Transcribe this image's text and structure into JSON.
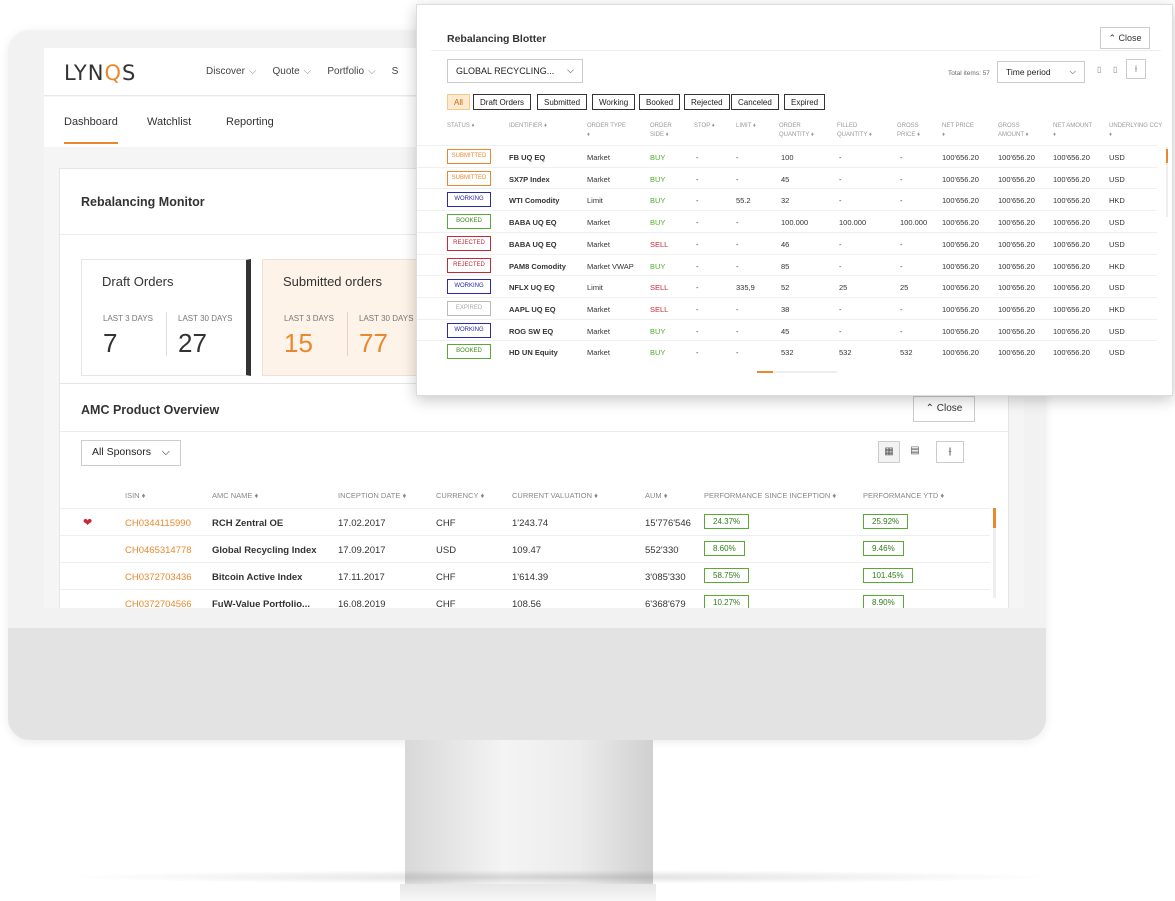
{
  "app": {
    "logo_left": "LYN",
    "logo_accent": "Q",
    "logo_right": "S",
    "nav": [
      "Discover",
      "Quote",
      "Portfolio",
      "S"
    ],
    "tabs": [
      "Dashboard",
      "Watchlist",
      "Reporting"
    ],
    "active_tab": "Dashboard",
    "accent_color": "#e8892f"
  },
  "rebalancing_monitor": {
    "title": "Rebalancing Monitor",
    "draft": {
      "title": "Draft Orders",
      "label_3": "LAST 3 DAYS",
      "label_30": "LAST 30 DAYS",
      "val_3": "7",
      "val_30": "27"
    },
    "submitted": {
      "title": "Submitted orders",
      "label_3": "LAST 3 DAYS",
      "label_30": "LAST 30 DAYS",
      "val_3": "15",
      "val_30": "77"
    }
  },
  "amc": {
    "title": "AMC Product Overview",
    "close_label": "Close",
    "sponsor_select": "All Sponsors",
    "columns": [
      "ISIN",
      "AMC NAME",
      "INCEPTION DATE",
      "CURRENCY",
      "CURRENT VALUATION",
      "AUM",
      "PERFORMANCE SINCE INCEPTION",
      "PERFORMANCE YTD"
    ],
    "rows": [
      {
        "isin": "CH0344115990",
        "name": "RCH Zentral OE",
        "date": "17.02.2017",
        "ccy": "CHF",
        "val": "1'243.74",
        "aum": "15'776'546",
        "perf": "24.37%",
        "ytd": "25.92%"
      },
      {
        "isin": "CH0465314778",
        "name": "Global Recycling Index",
        "date": "17.09.2017",
        "ccy": "USD",
        "val": "109.47",
        "aum": "552'330",
        "perf": "8.60%",
        "ytd": "9.46%"
      },
      {
        "isin": "CH0372703436",
        "name": "Bitcoin Active Index",
        "date": "17.11.2017",
        "ccy": "CHF",
        "val": "1'614.39",
        "aum": "3'085'330",
        "perf": "58.75%",
        "ytd": "101.45%"
      },
      {
        "isin": "CH0372704566",
        "name": "FuW-Value Portfolio...",
        "date": "16.08.2019",
        "ccy": "CHF",
        "val": "108.56",
        "aum": "6'368'679",
        "perf": "10.27%",
        "ytd": "8.90%"
      }
    ]
  },
  "blotter": {
    "title": "Rebalancing Blotter",
    "close_label": "Close",
    "product_select": "GLOBAL RECYCLING...",
    "total": "Total items: 57",
    "time_period": "Time period",
    "filters": [
      "All",
      "Draft Orders",
      "Submitted",
      "Working",
      "Booked",
      "Rejected",
      "Canceled",
      "Expired"
    ],
    "active_filter": "All",
    "columns": [
      "STATUS",
      "IDENTIFIER",
      "ORDER TYPE",
      "ORDER SIDE",
      "STOP",
      "LIMIT",
      "ORDER QUANTITY",
      "FILLED QUANTITY",
      "GROSS PRICE",
      "NET PRICE",
      "GROSS AMOUNT",
      "NET AMOUNT",
      "UNDERLYING CCY"
    ],
    "rows": [
      {
        "status": "SUBMITTED",
        "id": "FB UQ EQ",
        "type": "Market",
        "side": "BUY",
        "stop": "-",
        "limit": "-",
        "qty": "100",
        "filled": "-",
        "gross": "-",
        "net": "100'656.20",
        "gamt": "100'656.20",
        "namt": "100'656.20",
        "ccy": "USD"
      },
      {
        "status": "SUBMITTED",
        "id": "SX7P Index",
        "type": "Market",
        "side": "BUY",
        "stop": "-",
        "limit": "-",
        "qty": "45",
        "filled": "-",
        "gross": "-",
        "net": "100'656.20",
        "gamt": "100'656.20",
        "namt": "100'656.20",
        "ccy": "USD"
      },
      {
        "status": "WORKING",
        "id": "WTI Comodity",
        "type": "Limit",
        "side": "BUY",
        "stop": "-",
        "limit": "55.2",
        "qty": "32",
        "filled": "-",
        "gross": "-",
        "net": "100'656.20",
        "gamt": "100'656.20",
        "namt": "100'656.20",
        "ccy": "HKD"
      },
      {
        "status": "BOOKED",
        "id": "BABA UQ EQ",
        "type": "Market",
        "side": "BUY",
        "stop": "-",
        "limit": "-",
        "qty": "100.000",
        "filled": "100.000",
        "gross": "100.000",
        "net": "100'656.20",
        "gamt": "100'656.20",
        "namt": "100'656.20",
        "ccy": "USD"
      },
      {
        "status": "REJECTED",
        "id": "BABA UQ EQ",
        "type": "Market",
        "side": "SELL",
        "stop": "-",
        "limit": "-",
        "qty": "46",
        "filled": "-",
        "gross": "-",
        "net": "100'656.20",
        "gamt": "100'656.20",
        "namt": "100'656.20",
        "ccy": "USD"
      },
      {
        "status": "REJECTED",
        "id": "PAM8 Comodity",
        "type": "Market VWAP",
        "side": "BUY",
        "stop": "-",
        "limit": "-",
        "qty": "85",
        "filled": "-",
        "gross": "-",
        "net": "100'656.20",
        "gamt": "100'656.20",
        "namt": "100'656.20",
        "ccy": "HKD"
      },
      {
        "status": "WORKING",
        "id": "NFLX UQ EQ",
        "type": "Limit",
        "side": "SELL",
        "stop": "-",
        "limit": "335,9",
        "qty": "52",
        "filled": "25",
        "gross": "25",
        "net": "100'656.20",
        "gamt": "100'656.20",
        "namt": "100'656.20",
        "ccy": "USD"
      },
      {
        "status": "EXPIRED",
        "id": "AAPL UQ EQ",
        "type": "Market",
        "side": "SELL",
        "stop": "-",
        "limit": "-",
        "qty": "38",
        "filled": "-",
        "gross": "-",
        "net": "100'656.20",
        "gamt": "100'656.20",
        "namt": "100'656.20",
        "ccy": "HKD"
      },
      {
        "status": "WORKING",
        "id": "ROG SW EQ",
        "type": "Market",
        "side": "BUY",
        "stop": "-",
        "limit": "-",
        "qty": "45",
        "filled": "-",
        "gross": "-",
        "net": "100'656.20",
        "gamt": "100'656.20",
        "namt": "100'656.20",
        "ccy": "USD"
      },
      {
        "status": "BOOKED",
        "id": "HD UN Equity",
        "type": "Market",
        "side": "BUY",
        "stop": "-",
        "limit": "-",
        "qty": "532",
        "filled": "532",
        "gross": "532",
        "net": "100'656.20",
        "gamt": "100'656.20",
        "namt": "100'656.20",
        "ccy": "USD"
      }
    ]
  }
}
